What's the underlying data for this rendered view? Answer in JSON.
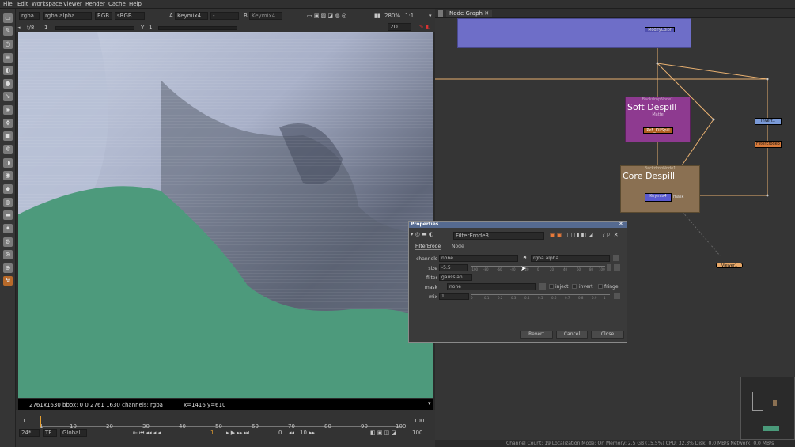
{
  "menu": [
    "File",
    "Edit",
    "Workspace",
    "Viewer",
    "Render",
    "Cache",
    "Help"
  ],
  "viewer": {
    "channel_set": "rgba",
    "channel_display": "rgba.alpha",
    "color_mode": "RGB",
    "lut": "sRGB",
    "input_a_prefix": "A",
    "input_a": "Keymix4",
    "input_b_prefix": "B",
    "input_b": "Keymix4",
    "wipe": "-",
    "zoom": "280%",
    "ratio": "1:1",
    "fstop": "f/8",
    "fstop_value": "1",
    "y_label": "Y",
    "y_value": "1",
    "view_mode": "2D",
    "format_info": "2761x1630  bbox: 0 0 2761 1630 channels: rgba",
    "coords": "x=1416 y=610"
  },
  "timeline": {
    "ticks": [
      "1",
      "10",
      "20",
      "30",
      "40",
      "50",
      "60",
      "70",
      "80",
      "90",
      "100"
    ],
    "start": "1",
    "end": "100",
    "end_right": "100",
    "fps": "24*",
    "tf": "TF",
    "scope": "Global",
    "current_frame": "1",
    "step": "10",
    "frame_zero": "0"
  },
  "graph": {
    "tab_label": "Node Graph",
    "nodes": {
      "top": "ModifyColor",
      "backdrop1_title": "BackdropNode1",
      "backdrop1_heading": "Soft Despill",
      "backdrop1_matte": "Matte",
      "backdrop1_node": "PxF_KillSpill",
      "backdrop2_title": "BackdropNode1",
      "backdrop2_heading": "Core Despill",
      "keymix": "Keymix4",
      "mask_label": "mask",
      "invert": "Invert1",
      "filtererode": "FilterErode3",
      "viewer": "Viewer1"
    }
  },
  "properties": {
    "title": "Properties",
    "node_name": "FilterErode3",
    "tabs": [
      "FilterErode",
      "Node"
    ],
    "channels_label": "channels",
    "channels_value": "none",
    "channels_value2": "rgba.alpha",
    "size_label": "size",
    "size_value": "-5.5",
    "size_ticks": [
      "-100",
      "-80",
      "-60",
      "-40",
      "-20",
      "0",
      "20",
      "40",
      "60",
      "80",
      "100"
    ],
    "filter_label": "filter",
    "filter_value": "gaussian",
    "mask_label": "mask",
    "mask_value": "none",
    "inject_label": "inject",
    "invert_label": "invert",
    "fringe_label": "fringe",
    "mix_label": "mix",
    "mix_value": "1",
    "mix_ticks": [
      "0",
      "0.1",
      "0.2",
      "0.3",
      "0.4",
      "0.5",
      "0.6",
      "0.7",
      "0.8",
      "0.9",
      "1"
    ],
    "revert": "Revert",
    "cancel": "Cancel",
    "close": "Close"
  },
  "status": "Channel Count: 19  Localization Mode: On  Memory: 2.5 GB (15.5%)  CPU: 32.3%  Disk: 0.0 MB/s  Network: 0.0 MB/s",
  "colors": {
    "backdrop_purple": "#8a3a8a",
    "backdrop_brown": "#8a7050",
    "top_backdrop": "#6a6ac8",
    "green_screen": "#4a9a7a"
  }
}
